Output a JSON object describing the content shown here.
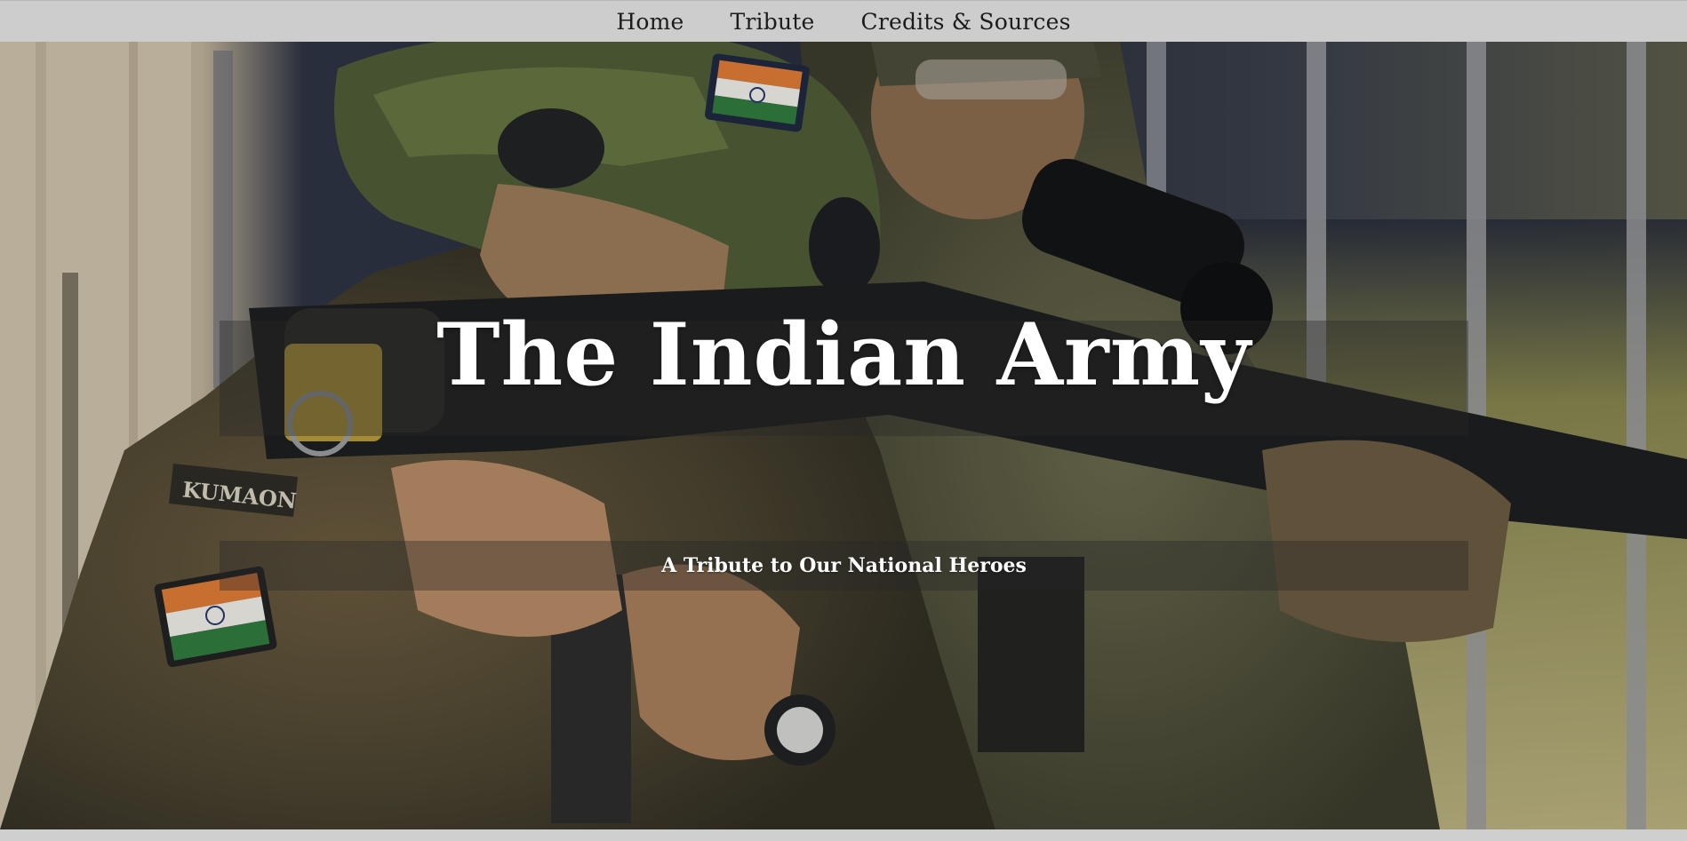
{
  "nav": {
    "items": [
      {
        "label": "Home"
      },
      {
        "label": "Tribute"
      },
      {
        "label": "Credits & Sources"
      }
    ]
  },
  "hero": {
    "title": "The Indian Army",
    "subtitle": "A Tribute to Our National Heroes",
    "patch_text": "KUMAON"
  },
  "colors": {
    "navbar_bg": "#cdcdcd",
    "overlay_band": "rgba(40,40,40,0.38)",
    "text_light": "#ffffff",
    "nav_text": "#1c1c1c"
  }
}
